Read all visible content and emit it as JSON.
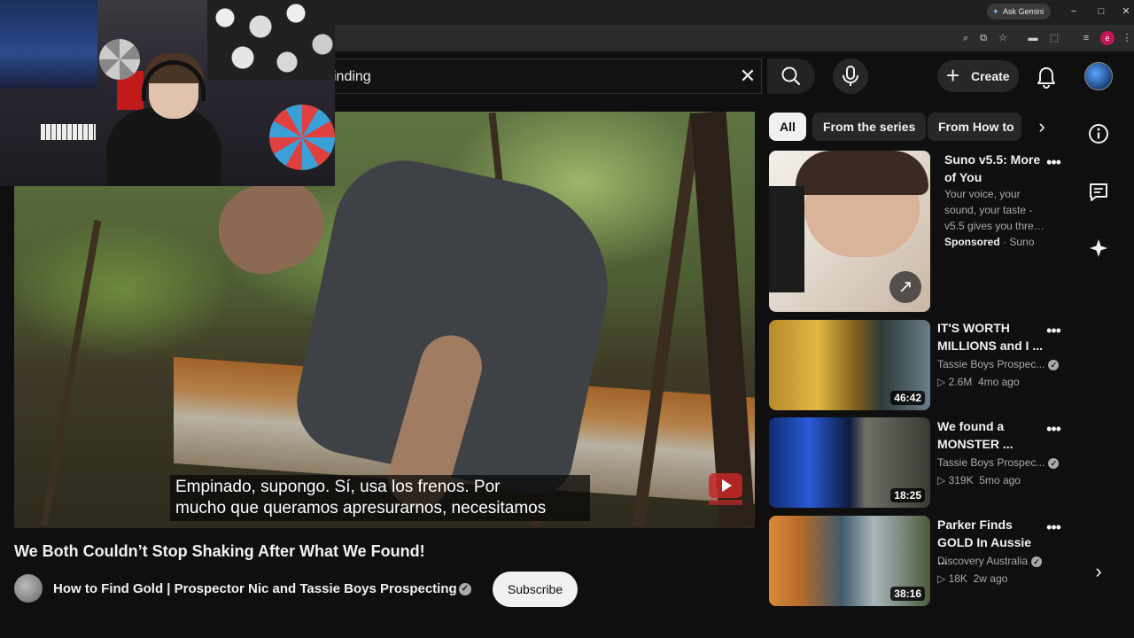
{
  "browser": {
    "ask_gemini_label": "Ask Gemini",
    "window_buttons": {
      "minimize": "−",
      "restore": "□",
      "close": "✕"
    },
    "profile_initial": "e"
  },
  "header": {
    "search_query_visible": "inding",
    "clear_glyph": "✕",
    "create_label": "Create",
    "create_glyph": "+"
  },
  "video": {
    "subtitle_line1": "Empinado, supongo.  Sí, usa los frenos.  Por",
    "subtitle_line2": "mucho que queramos apresurarnos, necesitamos",
    "title": "We Both Couldn’t Stop Shaking After What We Found!",
    "channel_name": "How to Find Gold | Prospector Nic and Tassie Boys Prospecting",
    "verified_glyph": "✓",
    "subscribe_label": "Subscribe"
  },
  "chips": [
    "All",
    "From the series",
    "From How to"
  ],
  "chip_next_glyph": "›",
  "recommendations": [
    {
      "title": "Suno v5.5: More of You",
      "description": "Your voice, your sound, your taste - v5.5 gives you thre…",
      "sponsored_label": "Sponsored",
      "advertiser": "Suno",
      "external_glyph": "↗"
    },
    {
      "title": "IT'S WORTH MILLIONS and I ...",
      "channel": "Tassie Boys Prospec...",
      "views": "2.6M",
      "age": "4mo ago",
      "duration": "46:42"
    },
    {
      "title": "We found a MONSTER ...",
      "channel": "Tassie Boys Prospec...",
      "views": "319K",
      "age": "5mo ago",
      "duration": "18:25"
    },
    {
      "title": "Parker Finds GOLD In Aussie ...",
      "channel": "Discovery Australia",
      "views": "18K",
      "age": "2w ago",
      "duration": "38:16"
    }
  ],
  "more_glyph": "•••",
  "play_glyph": "▷",
  "meta_separator": " ",
  "rail_next_glyph": "›",
  "colors": {
    "background": "#0f0f0f",
    "chip_active_bg": "#f1f1f1",
    "subscribe_bg": "#f1f1f1",
    "secondary_text": "#aaaaaa"
  }
}
